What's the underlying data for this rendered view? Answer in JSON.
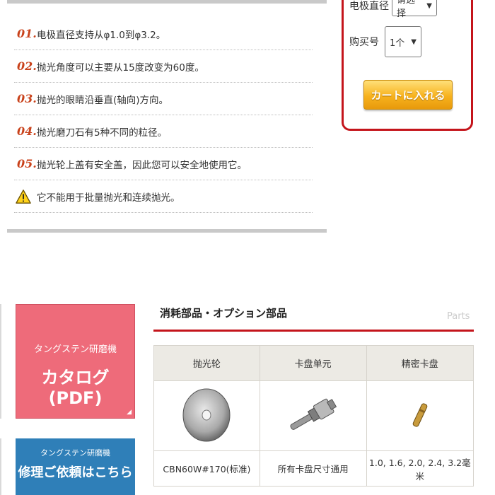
{
  "features": [
    {
      "num": "01.",
      "text": "电极直径支持从φ1.0到φ3.2。"
    },
    {
      "num": "02.",
      "text": "抛光角度可以主要从15度改变为60度。"
    },
    {
      "num": "03.",
      "text": "抛光的眼睛沿垂直(轴向)方向。"
    },
    {
      "num": "04.",
      "text": "抛光磨刀石有5种不同的粒径。"
    },
    {
      "num": "05.",
      "text": "抛光轮上盖有安全盖，因此您可以安全地使用它。"
    }
  ],
  "warning": {
    "text": "它不能用于批量抛光和连续抛光。",
    "icon": "warning-icon"
  },
  "purchase": {
    "electrode_label": "电极直径",
    "electrode_value": "请选择",
    "qty_label": "购买号",
    "qty_value": "1个",
    "cart_button": "カートに入れる"
  },
  "banners": {
    "catalog": {
      "sub": "タングステン研磨機",
      "main": "カタログ(PDF)"
    },
    "repair": {
      "sub": "タングステン研磨機",
      "main": "修理ご依頼はこちら"
    }
  },
  "parts": {
    "title": "消耗部品・オプション部品",
    "en_label": "Parts",
    "headers": [
      "抛光轮",
      "卡盘单元",
      "精密卡盘"
    ],
    "captions": [
      "CBN60W#170(标准)",
      "所有卡盘尺寸通用",
      "1.0, 1.6, 2.0, 2.4, 3.2毫米"
    ]
  },
  "colors": {
    "accent_red": "#c4141b",
    "number_orange": "#c9421b",
    "cart_orange": "#f7b21e",
    "banner_pink": "#ee6b7a",
    "banner_blue": "#2f7fb8"
  }
}
